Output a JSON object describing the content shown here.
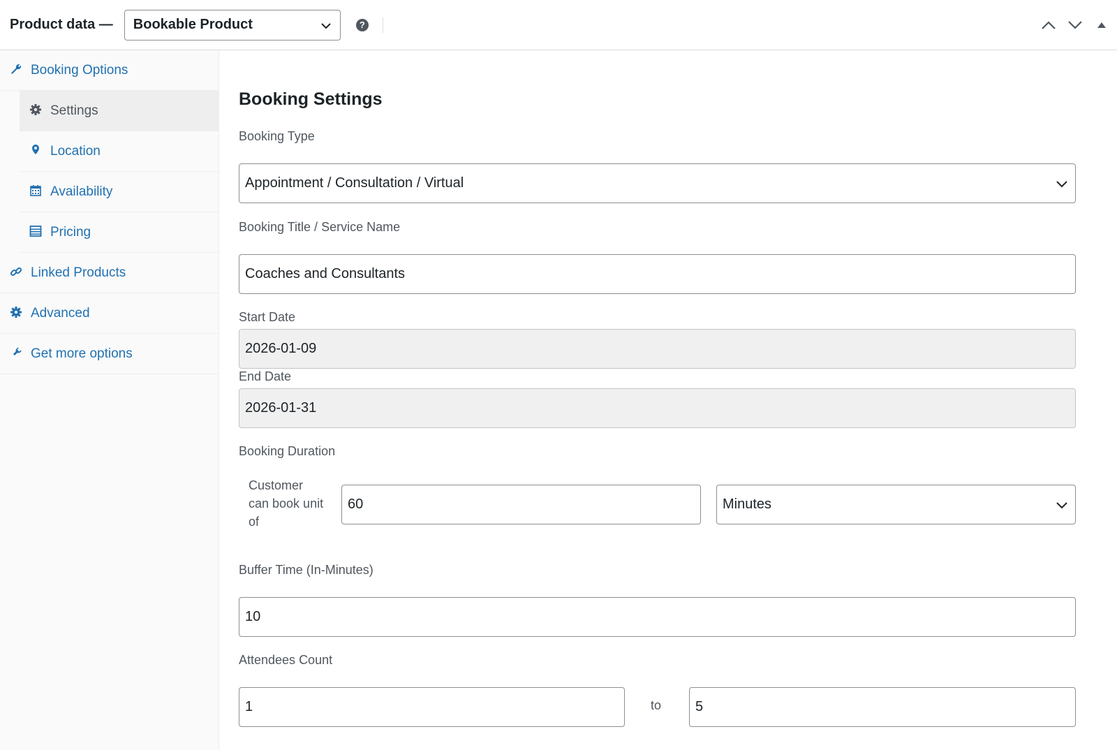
{
  "header": {
    "title": "Product data —",
    "product_type": "Bookable Product",
    "help": "?"
  },
  "sidebar": {
    "items": [
      {
        "label": "Booking Options",
        "icon": "wrench-icon"
      },
      {
        "label": "Settings",
        "icon": "gear-icon",
        "active": true
      },
      {
        "label": "Location",
        "icon": "location-pin-icon"
      },
      {
        "label": "Availability",
        "icon": "calendar-icon"
      },
      {
        "label": "Pricing",
        "icon": "list-table-icon"
      },
      {
        "label": "Linked Products",
        "icon": "link-icon"
      },
      {
        "label": "Advanced",
        "icon": "gear-icon"
      },
      {
        "label": "Get more options",
        "icon": "plugin-icon"
      }
    ]
  },
  "main": {
    "section_title": "Booking Settings",
    "booking_type": {
      "label": "Booking Type",
      "value": "Appointment / Consultation / Virtual"
    },
    "booking_title": {
      "label": "Booking Title / Service Name",
      "value": "Coaches and Consultants"
    },
    "start_date": {
      "label": "Start Date",
      "value": "2026-01-09"
    },
    "end_date": {
      "label": "End Date",
      "value": "2026-01-31"
    },
    "booking_duration": {
      "label": "Booking Duration",
      "sub_label": "Customer can book unit of",
      "value": "60",
      "unit": "Minutes"
    },
    "buffer_time": {
      "label": "Buffer Time (In-Minutes)",
      "value": "10"
    },
    "attendees": {
      "label": "Attendees Count",
      "min": "1",
      "to": "to",
      "max": "5"
    }
  },
  "colors": {
    "link": "#2271b1",
    "text": "#1d2327",
    "muted": "#50575e",
    "border": "#8c8f94",
    "disabled_bg": "#f0f0f1",
    "sidebar_bg": "#fafafa"
  }
}
